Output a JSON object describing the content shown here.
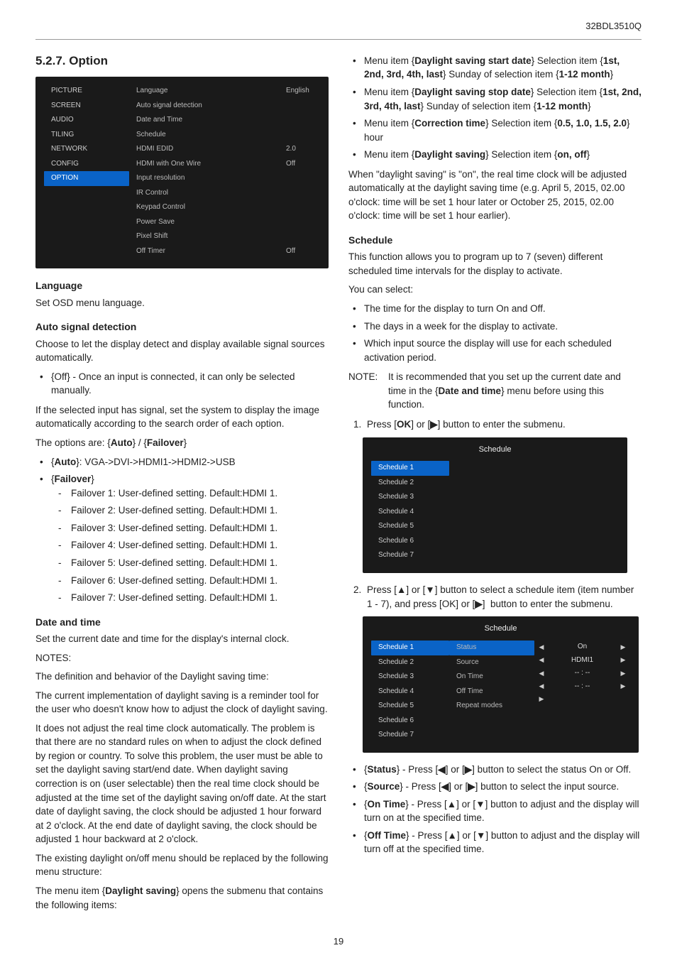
{
  "model": "32BDL3510Q",
  "section_number": "5.2.7.",
  "section_title": "Option",
  "osd1": {
    "left": [
      "PICTURE",
      "SCREEN",
      "AUDIO",
      "TILING",
      "NETWORK",
      "CONFIG",
      "OPTION"
    ],
    "left_selected": "OPTION",
    "mid": [
      "Language",
      "Auto signal detection",
      "Date and Time",
      "Schedule",
      "HDMI EDID",
      "HDMI with One Wire",
      "Input resolution",
      "IR Control",
      "Keypad Control",
      "Power Save",
      "Pixel Shift",
      "Off Timer"
    ],
    "right": [
      "English",
      "",
      "",
      "",
      "2.0",
      "Off",
      "",
      "",
      "",
      "",
      "",
      "Off"
    ]
  },
  "left": {
    "language_h": "Language",
    "language_p": "Set OSD menu language.",
    "asd_h": "Auto signal detection",
    "asd_p1": "Choose to let the display detect and display available signal sources automatically.",
    "asd_li": "{Off} - Once an input is connected, it can only be selected manually.",
    "asd_p2": "If the selected input has signal, set the system to display the image automatically according to the search order of each option.",
    "asd_p3": "The options are: {Auto} / {Failover}",
    "auto_li": "{Auto}: VGA->DVI->HDMI1->HDMI2->USB",
    "failover_li": "{Failover}",
    "failovers": [
      "Failover 1: User-defined setting. Default:HDMI 1.",
      "Failover 2: User-defined setting. Default:HDMI 1.",
      "Failover 3: User-defined setting. Default:HDMI 1.",
      "Failover 4: User-defined setting. Default:HDMI 1.",
      "Failover 5: User-defined setting. Default:HDMI 1.",
      "Failover 6: User-defined setting. Default:HDMI 1.",
      "Failover 7: User-defined setting. Default:HDMI 1."
    ],
    "dt_h": "Date and time",
    "dt_p1": "Set the current date and time for the display's internal clock.",
    "dt_p2": "NOTES:",
    "dt_p3": "The definition and behavior of the Daylight saving time:",
    "dt_p4": "The current implementation of daylight saving is a reminder tool for the user who doesn't know how to adjust the clock of daylight saving.",
    "dt_p5": "It does not adjust the real time clock automatically. The problem is that there are no standard rules on when to adjust the clock defined by region or country. To solve this problem, the user must be able to set the daylight saving start/end date. When daylight saving correction is on (user selectable) then the real time clock should be adjusted at the time set of the daylight saving on/off date. At the start date of daylight saving, the clock should be adjusted 1 hour forward at 2 o'clock. At the end date of daylight saving, the clock should be adjusted 1 hour backward at 2 o'clock.",
    "dt_p6": "The existing daylight on/off menu should be replaced by the following menu structure:",
    "dt_p7": "The menu item {Daylight saving} opens the submenu that contains the following items:"
  },
  "right": {
    "ds_items": [
      "Menu item {Daylight saving start date} Selection item {1st, 2nd, 3rd, 4th, last} Sunday of selection item {1-12 month}",
      "Menu item {Daylight saving stop date} Selection item {1st, 2nd, 3rd, 4th, last} Sunday of selection item {1-12 month}",
      "Menu item {Correction time} Selection item {0.5, 1.0, 1.5, 2.0} hour",
      "Menu item {Daylight saving} Selection item {on, off}"
    ],
    "ds_para": "When \"daylight saving\" is \"on\", the real time clock will be adjusted automatically at the daylight saving time (e.g. April 5, 2015, 02.00 o'clock: time will be set 1 hour later or October 25, 2015, 02.00 o'clock: time will be set 1 hour earlier).",
    "sched_h": "Schedule",
    "sched_p1": "This function allows you to program up to 7 (seven) different scheduled time intervals for the display to activate.",
    "sched_p2": "You can select:",
    "sched_bul": [
      "The time for the display to turn On and Off.",
      "The days in a week for the display to activate.",
      "Which input source the display will use for each scheduled activation period."
    ],
    "note_lbl": "NOTE:",
    "note_txt": "It is recommended that you set up the current date and time in the {Date and time} menu before using this function.",
    "step1": "Press [OK] or [▶] button to enter the submenu.",
    "step2": "Press [▲] or [▼] button to select a schedule item (item number 1 - 7), and press [OK] or [▶]  button to enter the submenu.",
    "sched_detail": [
      "{Status} - Press [◀] or [▶] button to select the status On or Off.",
      "{Source} - Press [◀] or [▶] button to select the input source.",
      "{On Time} - Press [▲] or [▼] button to adjust and the display will turn on at the specified time.",
      "{Off Time} - Press [▲] or [▼] button to adjust and the display will turn off at the specified time."
    ]
  },
  "osd_sched1": {
    "title": "Schedule",
    "items": [
      "Schedule 1",
      "Schedule 2",
      "Schedule 3",
      "Schedule 4",
      "Schedule 5",
      "Schedule 6",
      "Schedule 7"
    ],
    "selected": "Schedule 1"
  },
  "osd_sched2": {
    "title": "Schedule",
    "left": [
      "Schedule 1",
      "Schedule 2",
      "Schedule 3",
      "Schedule 4",
      "Schedule 5",
      "Schedule 6",
      "Schedule 7"
    ],
    "left_selected": "Schedule 1",
    "mid": [
      "Status",
      "Source",
      "On Time",
      "Off Time",
      "Repeat modes"
    ],
    "mid_selected": "Status",
    "vals": [
      {
        "l": "◀",
        "t": "On",
        "r": "▶"
      },
      {
        "l": "◀",
        "t": "HDMI1",
        "r": "▶"
      },
      {
        "l": "◀",
        "t": "--  :  --",
        "r": "▶"
      },
      {
        "l": "◀",
        "t": "--  :  --",
        "r": "▶"
      },
      {
        "l": "▶",
        "t": "",
        "r": ""
      }
    ]
  },
  "pagenum": "19"
}
